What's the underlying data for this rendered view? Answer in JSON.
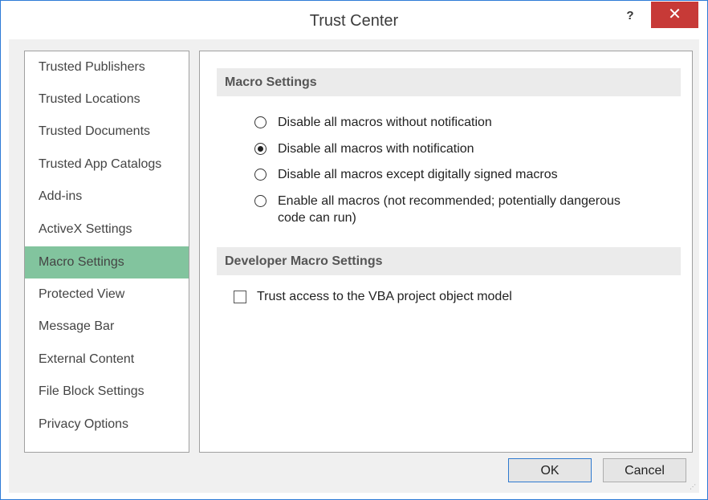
{
  "window": {
    "title": "Trust Center",
    "help_glyph": "?",
    "close_glyph": "✕"
  },
  "nav": {
    "items": [
      {
        "label": "Trusted Publishers"
      },
      {
        "label": "Trusted Locations"
      },
      {
        "label": "Trusted Documents"
      },
      {
        "label": "Trusted App Catalogs"
      },
      {
        "label": "Add-ins"
      },
      {
        "label": "ActiveX Settings"
      },
      {
        "label": "Macro Settings",
        "selected": true
      },
      {
        "label": "Protected View"
      },
      {
        "label": "Message Bar"
      },
      {
        "label": "External Content"
      },
      {
        "label": "File Block Settings"
      },
      {
        "label": "Privacy Options"
      }
    ],
    "selected_color": "#82c49e"
  },
  "macro_settings": {
    "header": "Macro Settings",
    "options": [
      {
        "label": "Disable all macros without notification",
        "checked": false
      },
      {
        "label": "Disable all macros with notification",
        "checked": true
      },
      {
        "label": "Disable all macros except digitally signed macros",
        "checked": false
      },
      {
        "label_line1": "Enable all macros (not recommended; potentially dangerous",
        "label_line2": "code can run)",
        "checked": false
      }
    ]
  },
  "developer_macro_settings": {
    "header": "Developer Macro Settings",
    "checkbox_label": "Trust access to the VBA project object model",
    "checked": false
  },
  "buttons": {
    "ok": "OK",
    "cancel": "Cancel"
  },
  "colors": {
    "close_button": "#c73a37",
    "window_border": "#2e7bd6",
    "ok_border": "#2f7ad0"
  }
}
